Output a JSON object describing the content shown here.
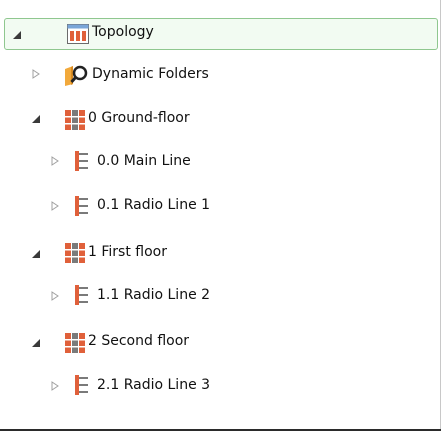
{
  "tree": {
    "nodes": [
      {
        "label": "Topology",
        "state": "expanded",
        "icon": "topology-icon",
        "selected": true
      },
      {
        "label": "Dynamic Folders",
        "state": "collapsed",
        "icon": "dynamic-folder-search-icon"
      },
      {
        "label": "0 Ground-floor",
        "state": "expanded",
        "icon": "building-floor-icon"
      },
      {
        "label": "0.0 Main Line",
        "state": "collapsed",
        "icon": "line-icon"
      },
      {
        "label": "0.1 Radio Line 1",
        "state": "collapsed",
        "icon": "line-icon"
      },
      {
        "label": "1 First floor",
        "state": "expanded",
        "icon": "building-floor-icon"
      },
      {
        "label": "1.1 Radio Line 2",
        "state": "collapsed",
        "icon": "line-icon"
      },
      {
        "label": "2 Second floor",
        "state": "expanded",
        "icon": "building-floor-icon"
      },
      {
        "label": "2.1 Radio Line 3",
        "state": "collapsed",
        "icon": "line-icon"
      }
    ]
  },
  "colors": {
    "selection_border": "#8fc78f",
    "selection_fill": "#f2fbf2",
    "icon_orange": "#e0603a",
    "icon_gray": "#7a7a7a",
    "folder_orange": "#f2a93b"
  }
}
